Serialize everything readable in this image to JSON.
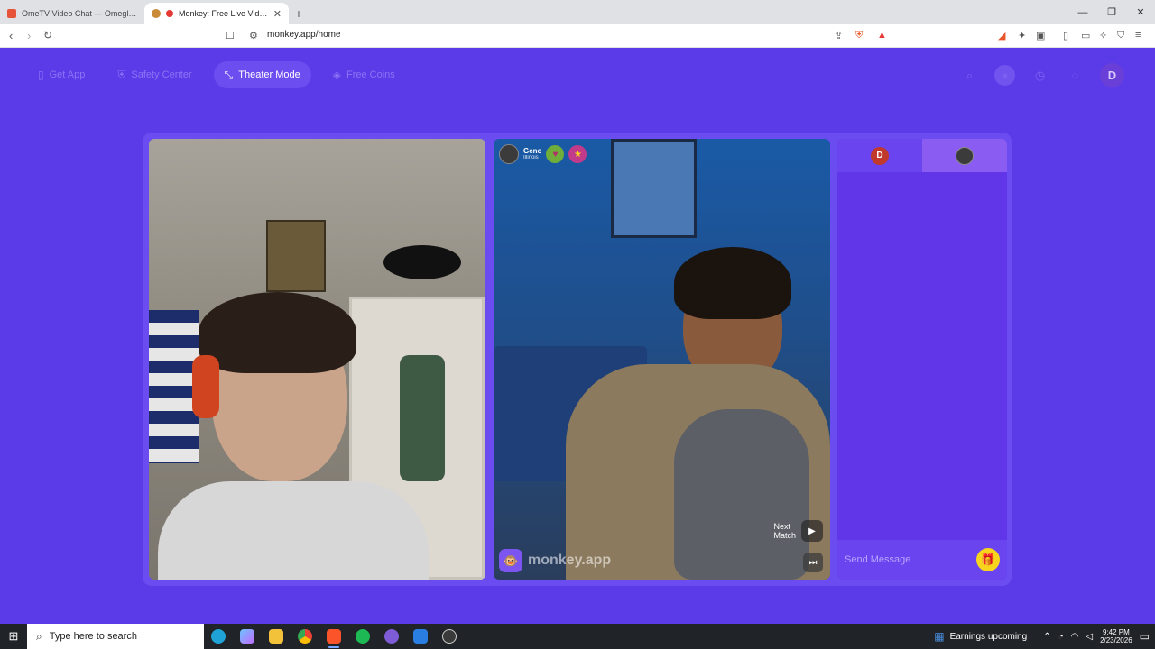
{
  "browser": {
    "tabs": [
      {
        "title": "OmeTV Video Chat — Omegle Random Cha",
        "active": false
      },
      {
        "title": "Monkey: Free Live Video Chat",
        "active": true
      }
    ],
    "url": "monkey.app/home"
  },
  "app": {
    "nav": [
      {
        "label": "Get App",
        "icon": "phone-icon"
      },
      {
        "label": "Safety Center",
        "icon": "shield-icon"
      },
      {
        "label": "Theater Mode",
        "icon": "expand-icon"
      },
      {
        "label": "Free Coins",
        "icon": "coins-icon"
      }
    ],
    "user_initial": "D"
  },
  "peer": {
    "name": "Geno",
    "location": "Illinois"
  },
  "video": {
    "watermark": "monkey.app",
    "next_match_line1": "Next",
    "next_match_line2": "Match"
  },
  "chat": {
    "me_initial": "D",
    "placeholder": "Send Message"
  },
  "taskbar": {
    "search_placeholder": "Type here to search",
    "earnings": "Earnings upcoming",
    "time": "9:42 PM",
    "date": "2/23/2026"
  },
  "colors": {
    "brand": "#5b3be8",
    "accent": "#f7d51d"
  }
}
